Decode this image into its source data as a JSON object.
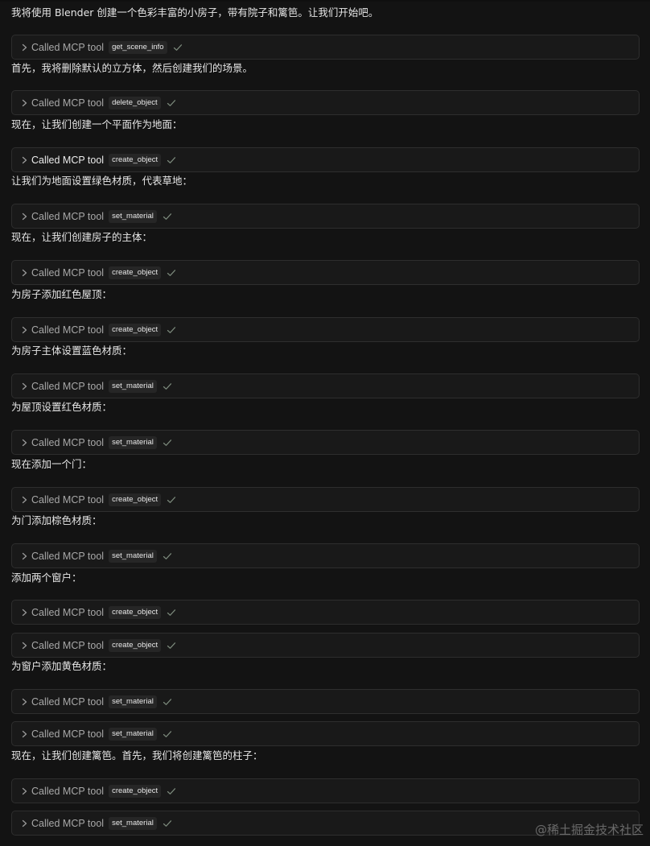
{
  "called_label": "Called MCP tool",
  "items": [
    {
      "kind": "message",
      "text": "我将使用 Blender 创建一个色彩丰富的小房子，带有院子和篱笆。让我们开始吧。"
    },
    {
      "kind": "tool",
      "tool": "get_scene_info",
      "status": "success"
    },
    {
      "kind": "message",
      "text": "首先，我将删除默认的立方体，然后创建我们的场景。"
    },
    {
      "kind": "tool",
      "tool": "delete_object",
      "status": "success"
    },
    {
      "kind": "message",
      "text": "现在，让我们创建一个平面作为地面："
    },
    {
      "kind": "tool",
      "tool": "create_object",
      "status": "success",
      "highlight": true
    },
    {
      "kind": "message",
      "text": "让我们为地面设置绿色材质，代表草地："
    },
    {
      "kind": "tool",
      "tool": "set_material",
      "status": "success"
    },
    {
      "kind": "message",
      "text": "现在，让我们创建房子的主体："
    },
    {
      "kind": "tool",
      "tool": "create_object",
      "status": "success"
    },
    {
      "kind": "message",
      "text": "为房子添加红色屋顶："
    },
    {
      "kind": "tool",
      "tool": "create_object",
      "status": "success"
    },
    {
      "kind": "message",
      "text": "为房子主体设置蓝色材质："
    },
    {
      "kind": "tool",
      "tool": "set_material",
      "status": "success"
    },
    {
      "kind": "message",
      "text": "为屋顶设置红色材质："
    },
    {
      "kind": "tool",
      "tool": "set_material",
      "status": "success"
    },
    {
      "kind": "message",
      "text": "现在添加一个门："
    },
    {
      "kind": "tool",
      "tool": "create_object",
      "status": "success"
    },
    {
      "kind": "message",
      "text": "为门添加棕色材质："
    },
    {
      "kind": "tool",
      "tool": "set_material",
      "status": "success"
    },
    {
      "kind": "message",
      "text": "添加两个窗户："
    },
    {
      "kind": "tool",
      "tool": "create_object",
      "status": "success"
    },
    {
      "kind": "tool",
      "tool": "create_object",
      "status": "success"
    },
    {
      "kind": "message",
      "text": "为窗户添加黄色材质："
    },
    {
      "kind": "tool",
      "tool": "set_material",
      "status": "success"
    },
    {
      "kind": "tool",
      "tool": "set_material",
      "status": "success"
    },
    {
      "kind": "message",
      "text": "现在，让我们创建篱笆。首先，我们将创建篱笆的柱子："
    },
    {
      "kind": "tool",
      "tool": "create_object",
      "status": "success"
    },
    {
      "kind": "tool",
      "tool": "set_material",
      "status": "success"
    }
  ],
  "watermark": "@稀土掘金技术社区",
  "icons": {
    "expand": "chevron-right-icon",
    "status": "checkmark-icon"
  },
  "colors": {
    "background": "#131313",
    "card": "#191919",
    "card_border": "#2e2e2e",
    "check": "#7c8a7c"
  }
}
